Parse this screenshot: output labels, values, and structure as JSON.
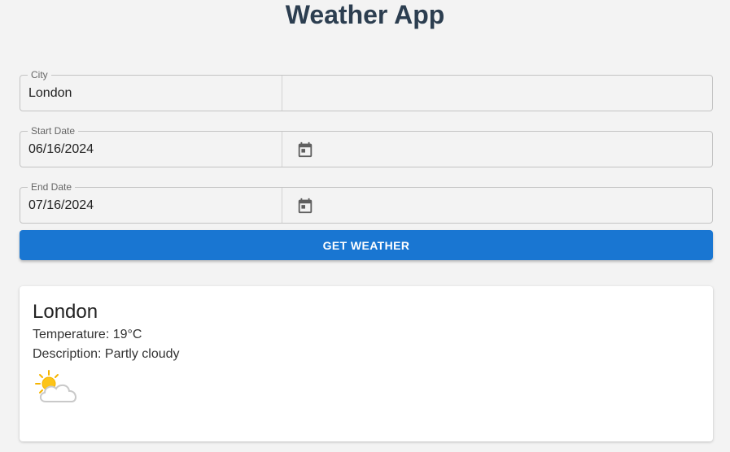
{
  "app": {
    "title": "Weather App"
  },
  "form": {
    "city": {
      "label": "City",
      "value": "London"
    },
    "start_date": {
      "label": "Start Date",
      "value": "06/16/2024"
    },
    "end_date": {
      "label": "End Date",
      "value": "07/16/2024"
    },
    "submit_label": "GET WEATHER"
  },
  "result": {
    "city": "London",
    "temperature": "Temperature: 19°C",
    "description": "Description: Partly cloudy",
    "icon": "partly-cloudy-icon"
  },
  "colors": {
    "accent": "#1976d2",
    "title": "#2c3e50",
    "background": "#f3f3f3"
  }
}
